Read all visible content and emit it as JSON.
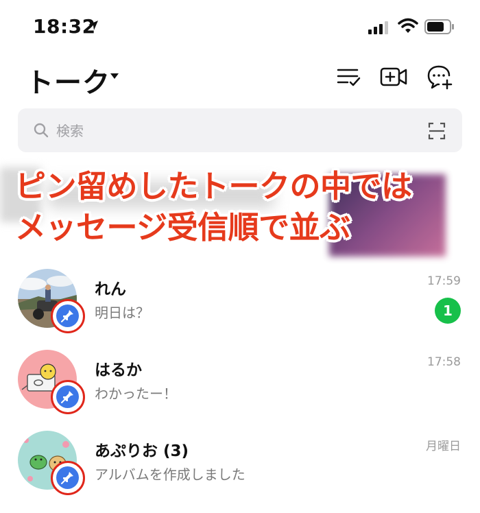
{
  "status_bar": {
    "time": "18:32"
  },
  "header": {
    "title": "トーク"
  },
  "search": {
    "placeholder": "検索"
  },
  "caption": {
    "line1": "ピン留めしたトークの中では",
    "line2": "メッセージ受信順で並ぶ"
  },
  "chats": [
    {
      "name": "れん",
      "preview": "明日は？",
      "time": "17:59",
      "unread": "1",
      "pinned": true
    },
    {
      "name": "はるか",
      "preview": "わかったー！",
      "time": "17:58",
      "pinned": true
    },
    {
      "name": "あぷりお (3)",
      "preview": "アルバムを作成しました",
      "time": "月曜日",
      "pinned": true
    }
  ],
  "colors": {
    "accent_red": "#e63a1c",
    "pin_blue": "#3c77e8",
    "unread_green": "#17c04a"
  }
}
